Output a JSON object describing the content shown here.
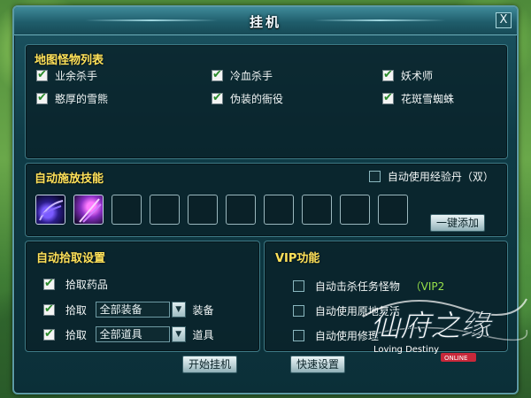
{
  "window": {
    "title": "挂机",
    "close_label": "X"
  },
  "monster_list": {
    "title": "地图怪物列表",
    "items": [
      {
        "label": "业余杀手",
        "checked": true
      },
      {
        "label": "冷血杀手",
        "checked": true
      },
      {
        "label": "妖术师",
        "checked": true
      },
      {
        "label": "憨厚的雪熊",
        "checked": true
      },
      {
        "label": "伪装的衙役",
        "checked": true
      },
      {
        "label": "花斑雪蜘蛛",
        "checked": true
      }
    ]
  },
  "skills": {
    "title": "自动施放技能",
    "auto_exp_pill_label": "自动使用经验丹（双）",
    "auto_exp_pill_checked": false,
    "filled_slots": 2,
    "empty_slots": 8,
    "one_click_add_label": "一键添加"
  },
  "pickup": {
    "title": "自动拾取设置",
    "pickup_medicine_label": "拾取药品",
    "pickup_label": "拾取",
    "equip_select_value": "全部装备",
    "equip_suffix": "装备",
    "item_select_value": "全部道具",
    "item_suffix": "道具"
  },
  "vip": {
    "title": "VIP功能",
    "items": [
      {
        "label": "自动击杀任务怪物",
        "tag": "（VIP2",
        "checked": false
      },
      {
        "label": "自动使用原地复活",
        "tag": "",
        "checked": false
      },
      {
        "label": "自动使用修理",
        "tag": "",
        "checked": false
      }
    ]
  },
  "footer": {
    "start_label": "开始挂机",
    "quick_settings_label": "快速设置"
  },
  "logo": {
    "text": "仙府之缘",
    "sub": "Loving Destiny",
    "tag": "ONLINE"
  },
  "colors": {
    "section_title": "#ffe25a",
    "vip_tag": "#98e24a",
    "window_bg": "#0f3c47"
  }
}
